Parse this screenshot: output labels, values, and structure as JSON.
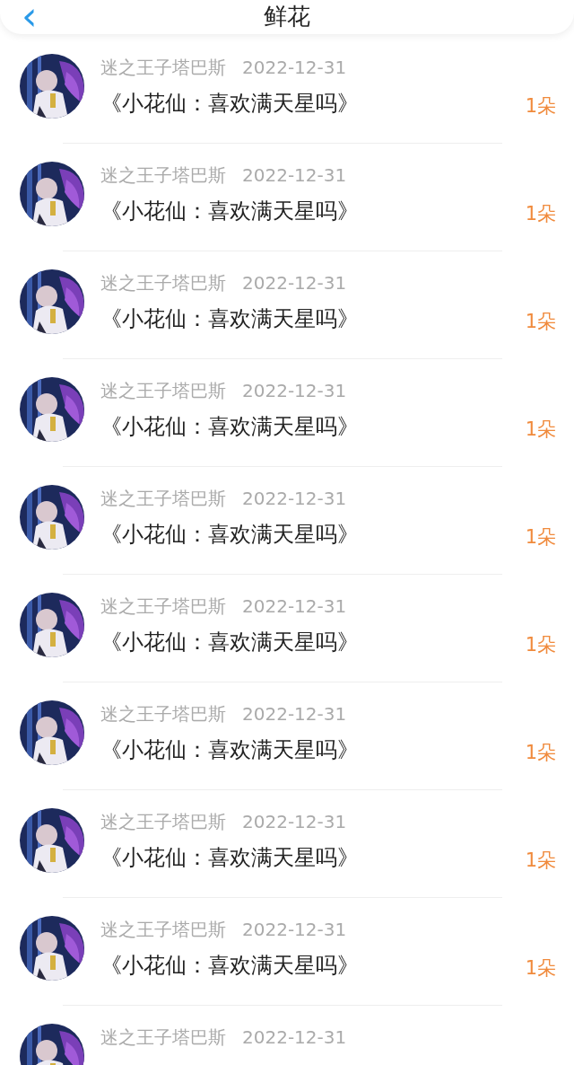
{
  "header": {
    "back_icon": "‹",
    "title": "鲜花"
  },
  "gifts": [
    {
      "user": "迷之王子塔巴斯",
      "date": "2022-12-31",
      "title": "《小花仙：喜欢满天星吗》",
      "count": "1朵"
    },
    {
      "user": "迷之王子塔巴斯",
      "date": "2022-12-31",
      "title": "《小花仙：喜欢满天星吗》",
      "count": "1朵"
    },
    {
      "user": "迷之王子塔巴斯",
      "date": "2022-12-31",
      "title": "《小花仙：喜欢满天星吗》",
      "count": "1朵"
    },
    {
      "user": "迷之王子塔巴斯",
      "date": "2022-12-31",
      "title": "《小花仙：喜欢满天星吗》",
      "count": "1朵"
    },
    {
      "user": "迷之王子塔巴斯",
      "date": "2022-12-31",
      "title": "《小花仙：喜欢满天星吗》",
      "count": "1朵"
    },
    {
      "user": "迷之王子塔巴斯",
      "date": "2022-12-31",
      "title": "《小花仙：喜欢满天星吗》",
      "count": "1朵"
    },
    {
      "user": "迷之王子塔巴斯",
      "date": "2022-12-31",
      "title": "《小花仙：喜欢满天星吗》",
      "count": "1朵"
    },
    {
      "user": "迷之王子塔巴斯",
      "date": "2022-12-31",
      "title": "《小花仙：喜欢满天星吗》",
      "count": "1朵"
    },
    {
      "user": "迷之王子塔巴斯",
      "date": "2022-12-31",
      "title": "《小花仙：喜欢满天星吗》",
      "count": "1朵"
    },
    {
      "user": "迷之王子塔巴斯",
      "date": "2022-12-31"
    }
  ]
}
